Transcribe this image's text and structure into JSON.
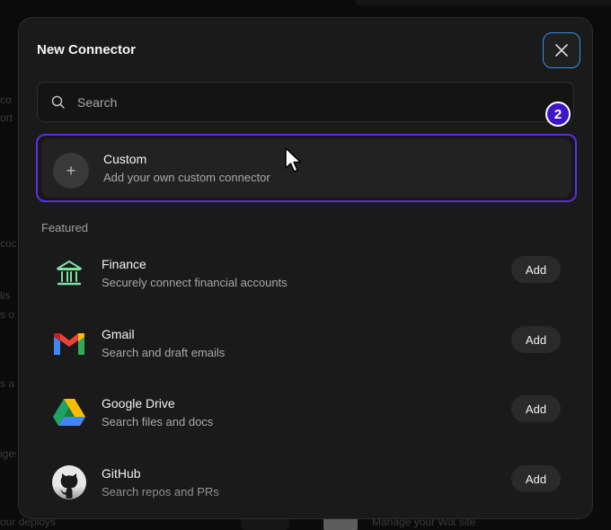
{
  "background": {
    "left_fragments": [
      "co",
      "ort",
      "coc",
      "lis",
      "s o",
      "s a",
      "iges"
    ],
    "bottom_left": "our deploys",
    "bottom_right": "Manage your Wix site"
  },
  "modal": {
    "title": "New Connector",
    "close_icon": "close-icon"
  },
  "search": {
    "placeholder": "Search",
    "value": ""
  },
  "custom": {
    "title": "Custom",
    "subtitle": "Add your own custom connector",
    "plus": "+",
    "badge": "2"
  },
  "featured": {
    "label": "Featured",
    "add_label": "Add",
    "items": [
      {
        "title": "Finance",
        "subtitle": "Securely connect financial accounts",
        "icon": "bank-icon"
      },
      {
        "title": "Gmail",
        "subtitle": "Search and draft emails",
        "icon": "gmail-icon"
      },
      {
        "title": "Google Drive",
        "subtitle": "Search files and docs",
        "icon": "google-drive-icon"
      },
      {
        "title": "GitHub",
        "subtitle": "Search repos and PRs",
        "icon": "github-icon"
      }
    ]
  },
  "colors": {
    "accent_border": "#5b2ee8",
    "badge": "#3d16c9",
    "close_border": "#3a8ee6",
    "finance_green": "#7fe0a0"
  }
}
